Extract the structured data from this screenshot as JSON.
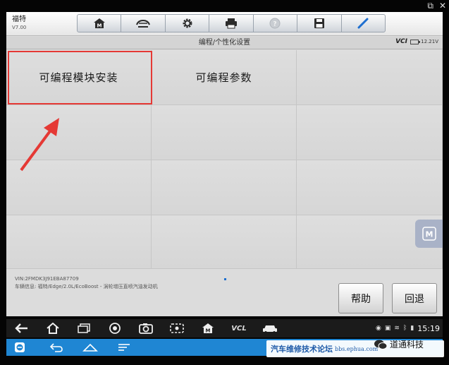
{
  "window": {
    "corner_icons": [
      "external-link-icon",
      "close-icon"
    ]
  },
  "header": {
    "brand": "福特",
    "version": "V7.00",
    "toolbar": [
      {
        "name": "home-icon"
      },
      {
        "name": "vehicle-icon"
      },
      {
        "name": "gear-icon"
      },
      {
        "name": "printer-icon"
      },
      {
        "name": "help-icon"
      },
      {
        "name": "save-icon"
      },
      {
        "name": "pen-icon"
      }
    ]
  },
  "subbar": {
    "title": "编程/个性化设置",
    "vci_label": "VCI",
    "voltage": "12.21V"
  },
  "grid": {
    "items": [
      {
        "label": "可编程模块安装",
        "selected": true
      },
      {
        "label": "可编程参数"
      },
      {
        "label": ""
      },
      {
        "label": ""
      },
      {
        "label": ""
      },
      {
        "label": ""
      },
      {
        "label": ""
      },
      {
        "label": ""
      },
      {
        "label": ""
      },
      {
        "label": ""
      },
      {
        "label": ""
      },
      {
        "label": ""
      }
    ]
  },
  "info": {
    "vin": "VIN:2FMDK3J91EBA87709",
    "vehicle": "车辆信息: 福特/Edge/2.0L/EcoBoost - 涡轮增压直喷汽油发动机"
  },
  "buttons": {
    "help": "帮助",
    "back": "回退"
  },
  "navbar": {
    "vcl_label": "VCL",
    "time": "15:19"
  },
  "watermark": {
    "forum": "汽车维修技术论坛",
    "url": "bbs.ephua.com",
    "brand": "道通科技"
  },
  "colors": {
    "highlight": "#e53935",
    "nav_blue": "#1f86d3"
  }
}
